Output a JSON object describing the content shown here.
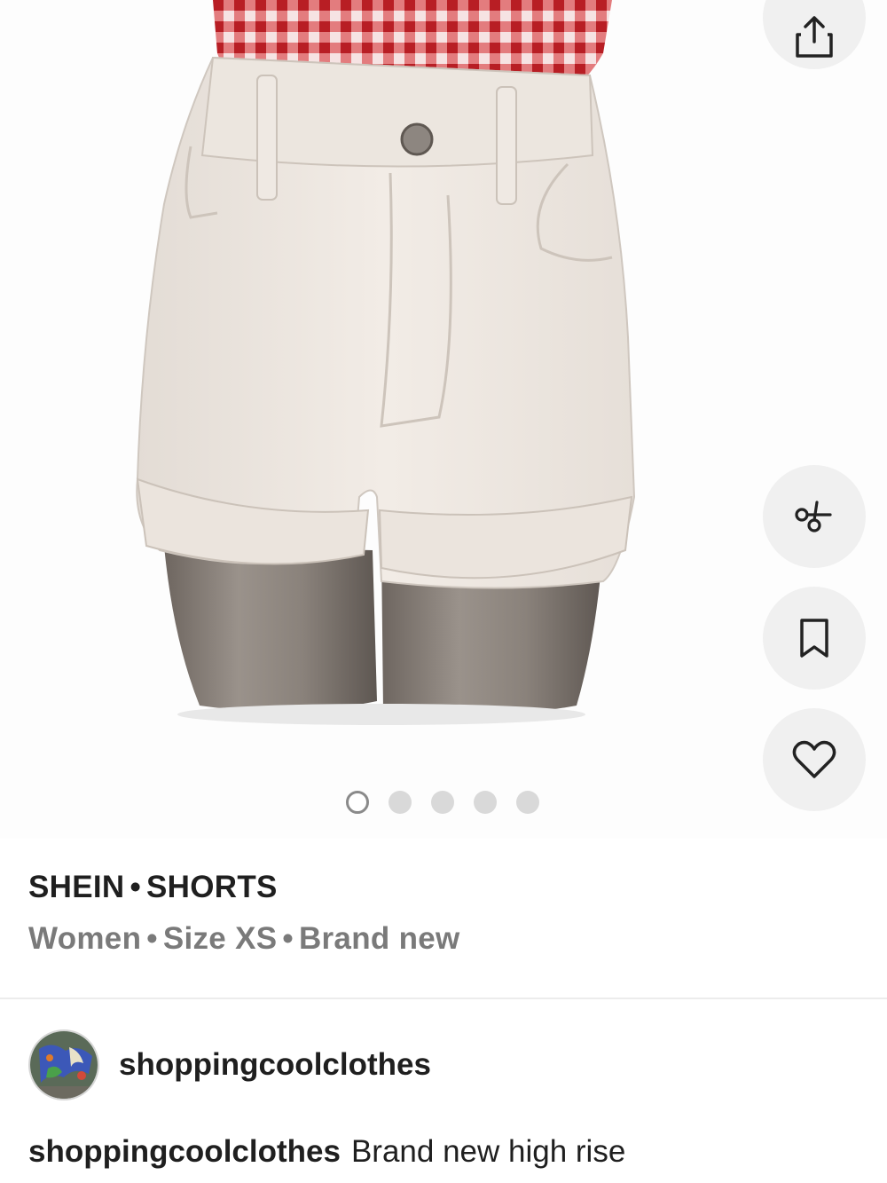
{
  "listing": {
    "brand": "SHEIN",
    "category": "SHORTS",
    "separator": "•",
    "gender": "Women",
    "size": "Size XS",
    "condition": "Brand new"
  },
  "carousel": {
    "total": 5,
    "active_index": 0
  },
  "actions": {
    "share_icon": "share-icon",
    "style_icon": "outfit-icon",
    "save_icon": "bookmark-icon",
    "like_icon": "heart-icon"
  },
  "seller": {
    "username": "shoppingcoolclothes"
  },
  "description": {
    "username": "shoppingcoolclothes",
    "text": "Brand new high rise"
  },
  "colors": {
    "fab_bg": "#f0f0f0",
    "title": "#1f1f1f",
    "subtitle": "#7a7a7a",
    "gingham_red": "#c8282d"
  }
}
